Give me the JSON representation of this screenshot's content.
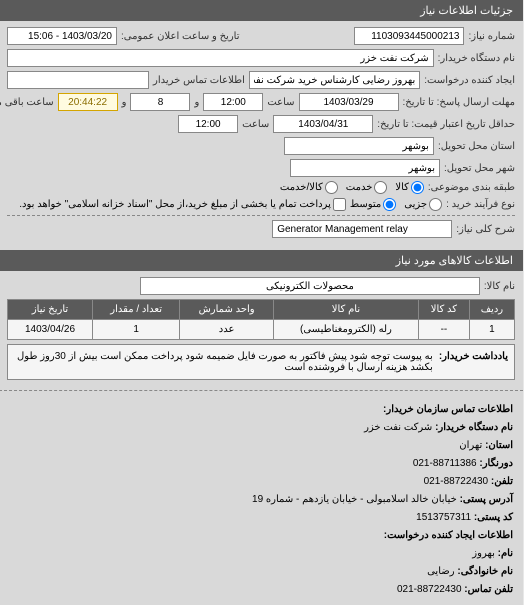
{
  "header": {
    "title": "جزئیات اطلاعات نیاز"
  },
  "form": {
    "request_number_label": "شماره نیاز:",
    "request_number": "1103093445000213",
    "datetime_label": "تاریخ و ساعت اعلان عمومی:",
    "datetime": "1403/03/20 - 15:06",
    "buyer_org_label": "نام دستگاه خریدار:",
    "buyer_org": "شرکت نفت خزر",
    "creator_label": "ایجاد کننده درخواست:",
    "creator": "بهروز رضایی کارشناس خرید شرکت نفت خزر",
    "buyer_contact_info_label": "اطلاعات تماس خریدار",
    "buyer_contact_info": "",
    "deadline_label": "مهلت ارسال پاسخ: تا تاریخ:",
    "deadline_date": "1403/03/29",
    "time_label": "ساعت",
    "deadline_time": "12:00",
    "and_label": "و",
    "days_remaining": "8",
    "time_remaining": "20:44:22",
    "time_remaining_label": "ساعت باقی مانده",
    "validity_label": "حداقل تاریخ اعتبار قیمت: تا تاریخ:",
    "validity_date": "1403/04/31",
    "validity_time": "12:00",
    "delivery_province_label": "استان محل تحویل:",
    "delivery_province": "بوشهر",
    "delivery_city_label": "شهر محل تحویل:",
    "delivery_city": "بوشهر",
    "budget_class_label": "طبقه بندی موضوعی:",
    "budget_opt_goods": "کالا",
    "budget_opt_service": "خدمت",
    "budget_opt_both": "کالا/خدمت",
    "process_type_label": "نوع فرآیند خرید :",
    "process_opt_partial": "جزیی",
    "process_opt_medium": "متوسط",
    "process_note": "پرداخت تمام یا بخشی از مبلغ خرید،از محل \"اسناد خزانه اسلامی\" خواهد بود.",
    "general_desc_label": "شرح کلی نیاز:",
    "general_desc": "Generator Management relay"
  },
  "items_section": {
    "title": "اطلاعات کالاهای مورد نیاز",
    "item_name_label": "نام کالا:",
    "item_name": "محصولات الکترونیکی",
    "columns": {
      "row": "ردیف",
      "code": "کد کالا",
      "name": "نام کالا",
      "unit": "واحد شمارش",
      "qty": "تعداد / مقدار",
      "date": "تاریخ نیاز"
    },
    "rows": [
      {
        "row": "1",
        "code": "--",
        "name": "رله (الکترومغناطیسی)",
        "unit": "عدد",
        "qty": "1",
        "date": "1403/04/26"
      }
    ],
    "note_label": "یادداشت خریدار:",
    "note_text": "به پیوست توجه شود پیش فاکتور به صورت فایل ضمیمه شود پرداخت ممکن است بیش از 30روز طول بکشد هزینه ارسال با فروشنده است"
  },
  "contact": {
    "title": "اطلاعات تماس سازمان خریدار:",
    "org_label": "نام دستگاه خریدار:",
    "org": "شرکت نفت خزر",
    "province_label": "استان:",
    "province": "تهران",
    "fax_label": "دورنگار:",
    "fax": "88711386-021",
    "phone_label": "تلفن:",
    "phone": "88722430-021",
    "address_label": "آدرس پستی:",
    "address": "خیابان خالد اسلامبولی - خیابان یازدهم - شماره 19",
    "postal_label": "کد پستی:",
    "postal": "1513757311",
    "creator_section_label": "اطلاعات ایجاد کننده درخواست:",
    "name_label": "نام:",
    "name": "بهروز",
    "lname_label": "نام خانوادگی:",
    "lname": "رضایی",
    "contact_phone_label": "تلفن تماس:",
    "contact_phone": "88722430-021"
  }
}
